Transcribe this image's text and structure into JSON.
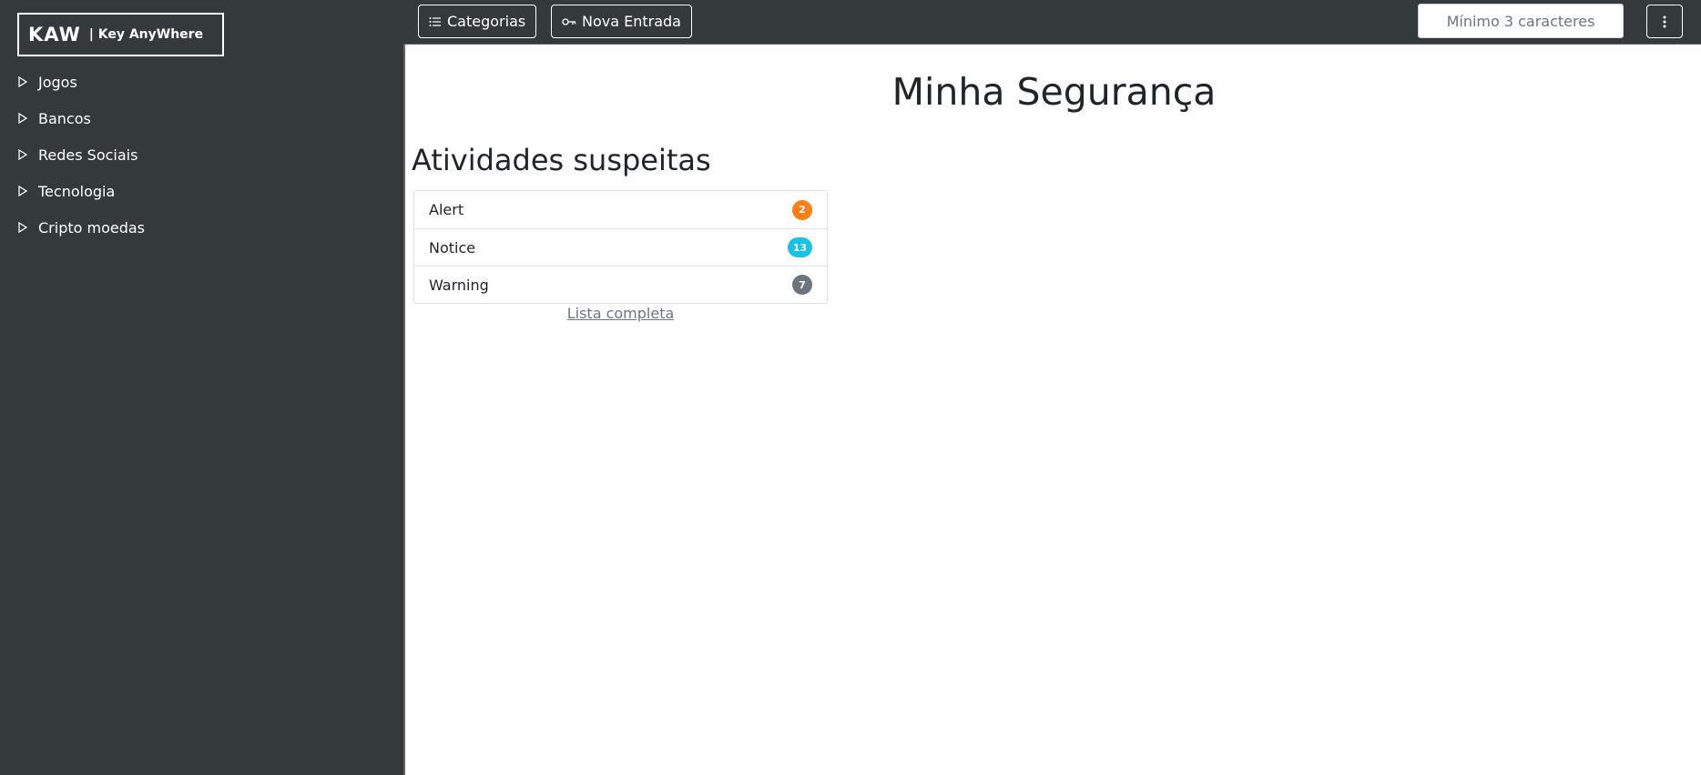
{
  "logo": {
    "main": "KAW",
    "sub": "| Key AnyWhere"
  },
  "sidebar": {
    "items": [
      {
        "label": "Jogos"
      },
      {
        "label": "Bancos"
      },
      {
        "label": "Redes Sociais"
      },
      {
        "label": "Tecnologia"
      },
      {
        "label": "Cripto moedas"
      }
    ]
  },
  "topbar": {
    "categories_label": "Categorias",
    "categories_icon": "list-icon",
    "new_entry_label": "Nova Entrada",
    "new_entry_icon": "key-icon",
    "search_placeholder": "Mínimo 3 caracteres",
    "menu_icon": "kebab-menu-icon"
  },
  "main": {
    "title": "Minha Segurança",
    "section_title": "Atividades suspeitas",
    "activities": [
      {
        "label": "Alert",
        "count": "2",
        "color": "#fd7e14"
      },
      {
        "label": "Notice",
        "count": "13",
        "color": "#17c1e8"
      },
      {
        "label": "Warning",
        "count": "7",
        "color": "#6c757d"
      }
    ],
    "full_list_link": "Lista completa"
  }
}
